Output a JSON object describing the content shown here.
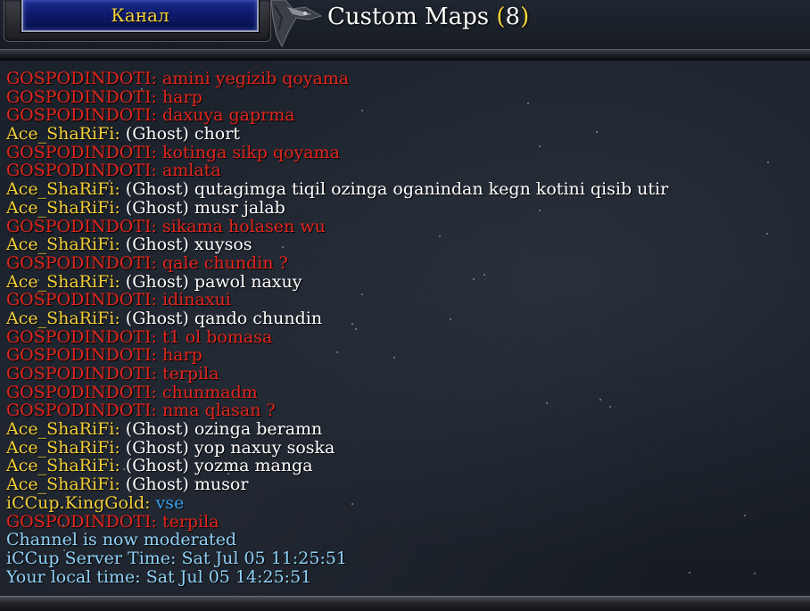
{
  "header": {
    "channel_button_label": "Канал",
    "title_text": "Custom Maps",
    "title_paren_open": "(",
    "title_count": "8",
    "title_paren_close": ")"
  },
  "colors": {
    "red_user": "#e0261d",
    "yellow_user": "#f2cf3a",
    "white_text": "#ffffff",
    "blue_text": "#38a0e8",
    "system_text": "#8fd0f5"
  },
  "chat": {
    "messages": [
      {
        "name": "GOSPODINDOTI:",
        "name_color": "#e0261d",
        "prefix": "",
        "text": "amini yegizib qoyama",
        "text_color": "#e0261d"
      },
      {
        "name": "GOSPODINDOTI:",
        "name_color": "#e0261d",
        "prefix": "",
        "text": "harp",
        "text_color": "#e0261d"
      },
      {
        "name": "GOSPODINDOTI:",
        "name_color": "#e0261d",
        "prefix": "",
        "text": "daxuya gaprma",
        "text_color": "#e0261d"
      },
      {
        "name": "Ace_ShaRiFi:",
        "name_color": "#f2cf3a",
        "prefix": "(Ghost)",
        "text": "chort",
        "text_color": "#ffffff"
      },
      {
        "name": "GOSPODINDOTI:",
        "name_color": "#e0261d",
        "prefix": "",
        "text": "kotinga sikp qoyama",
        "text_color": "#e0261d"
      },
      {
        "name": "GOSPODINDOTI:",
        "name_color": "#e0261d",
        "prefix": "",
        "text": "amlata",
        "text_color": "#e0261d"
      },
      {
        "name": "Ace_ShaRiFi:",
        "name_color": "#f2cf3a",
        "prefix": "(Ghost)",
        "text": "qutagimga tiqil ozinga oganindan kegn kotini qisib utir",
        "text_color": "#ffffff"
      },
      {
        "name": "Ace_ShaRiFi:",
        "name_color": "#f2cf3a",
        "prefix": "(Ghost)",
        "text": "musr jalab",
        "text_color": "#ffffff"
      },
      {
        "name": "GOSPODINDOTI:",
        "name_color": "#e0261d",
        "prefix": "",
        "text": "sikama holasen wu",
        "text_color": "#e0261d"
      },
      {
        "name": "Ace_ShaRiFi:",
        "name_color": "#f2cf3a",
        "prefix": "(Ghost)",
        "text": "xuysos",
        "text_color": "#ffffff"
      },
      {
        "name": "GOSPODINDOTI:",
        "name_color": "#e0261d",
        "prefix": "",
        "text": "qale chundin ?",
        "text_color": "#e0261d"
      },
      {
        "name": "Ace_ShaRiFi:",
        "name_color": "#f2cf3a",
        "prefix": "(Ghost)",
        "text": "pawol naxuy",
        "text_color": "#ffffff"
      },
      {
        "name": "GOSPODINDOTI:",
        "name_color": "#e0261d",
        "prefix": "",
        "text": "idinaxui",
        "text_color": "#e0261d"
      },
      {
        "name": "Ace_ShaRiFi:",
        "name_color": "#f2cf3a",
        "prefix": "(Ghost)",
        "text": "qando chundin",
        "text_color": "#ffffff"
      },
      {
        "name": "GOSPODINDOTI:",
        "name_color": "#e0261d",
        "prefix": "",
        "text": "t1 ol bomasa",
        "text_color": "#e0261d"
      },
      {
        "name": "GOSPODINDOTI:",
        "name_color": "#e0261d",
        "prefix": "",
        "text": "harp",
        "text_color": "#e0261d"
      },
      {
        "name": "GOSPODINDOTI:",
        "name_color": "#e0261d",
        "prefix": "",
        "text": "terpila",
        "text_color": "#e0261d"
      },
      {
        "name": "GOSPODINDOTI:",
        "name_color": "#e0261d",
        "prefix": "",
        "text": "chunmadm",
        "text_color": "#e0261d"
      },
      {
        "name": "GOSPODINDOTI:",
        "name_color": "#e0261d",
        "prefix": "",
        "text": "nma qlasan ?",
        "text_color": "#e0261d"
      },
      {
        "name": "Ace_ShaRiFi:",
        "name_color": "#f2cf3a",
        "prefix": "(Ghost)",
        "text": "ozinga beramn",
        "text_color": "#ffffff"
      },
      {
        "name": "Ace_ShaRiFi:",
        "name_color": "#f2cf3a",
        "prefix": "(Ghost)",
        "text": "yop naxuy soska",
        "text_color": "#ffffff"
      },
      {
        "name": "Ace_ShaRiFi:",
        "name_color": "#f2cf3a",
        "prefix": "(Ghost)",
        "text": "yozma manga",
        "text_color": "#ffffff"
      },
      {
        "name": "Ace_ShaRiFi:",
        "name_color": "#f2cf3a",
        "prefix": "(Ghost)",
        "text": "musor",
        "text_color": "#ffffff"
      },
      {
        "name": "iCCup.KingGold:",
        "name_color": "#f2cf3a",
        "prefix": "",
        "text": "vse",
        "text_color": "#38a0e8"
      },
      {
        "name": "GOSPODINDOTI:",
        "name_color": "#e0261d",
        "prefix": "",
        "text": "terpila",
        "text_color": "#e0261d"
      },
      {
        "name": "",
        "name_color": "#8fd0f5",
        "prefix": "",
        "text": "Channel is now moderated",
        "text_color": "#8fd0f5"
      },
      {
        "name": "",
        "name_color": "#8fd0f5",
        "prefix": "",
        "text": "iCCup Server Time: Sat Jul 05 11:25:51",
        "text_color": "#8fd0f5"
      },
      {
        "name": "",
        "name_color": "#8fd0f5",
        "prefix": "",
        "text": "Your local time: Sat Jul 05 14:25:51",
        "text_color": "#8fd0f5"
      }
    ]
  }
}
